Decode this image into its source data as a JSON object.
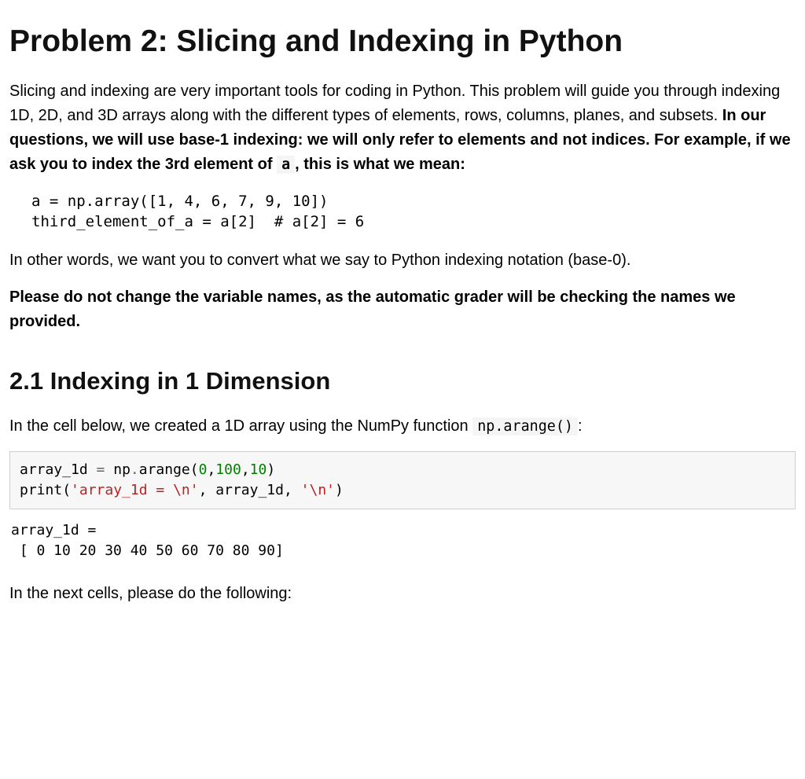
{
  "title": "Problem 2: Slicing and Indexing in Python",
  "intro": {
    "lead": "Slicing and indexing are very important tools for coding in Python. This problem will guide you through indexing 1D, 2D, and 3D arrays along with the different types of elements, rows, columns, planes, and subsets. ",
    "bold_part_a": "In our questions, we will use base-1 indexing: we will only refer to elements and not indices. For example, if we ask you to index the 3rd element of ",
    "code_a": "a",
    "bold_part_b": ", this is what we mean:"
  },
  "example_code": "a = np.array([1, 4, 6, 7, 9, 10])\nthird_element_of_a = a[2]  # a[2] = 6",
  "after_example": "In other words, we want you to convert what we say to Python indexing notation (base-0).",
  "bold_note": "Please do not change the variable names, as the automatic grader will be checking the names we provided.",
  "section_2_1": {
    "heading": "2.1 Indexing in 1 Dimension",
    "lead_a": "In the cell below, we created a 1D array using the NumPy function ",
    "code_inline": "np.arange()",
    "lead_b": ":",
    "code_tokens": {
      "l1_a": "array_1d ",
      "l1_eq": "=",
      "l1_b": " np",
      "l1_dot": ".",
      "l1_c": "arange(",
      "n0": "0",
      "comma1": ",",
      "n100": "100",
      "comma2": ",",
      "n10": "10",
      "l1_d": ")",
      "l2_a": "print",
      "l2_paren": "(",
      "s1": "'array_1d = \\n'",
      "l2_c": ", array_1d, ",
      "s2": "'\\n'",
      "l2_d": ")"
    },
    "output": "array_1d = \n [ 0 10 20 30 40 50 60 70 80 90]",
    "after": "In the next cells, please do the following:"
  }
}
